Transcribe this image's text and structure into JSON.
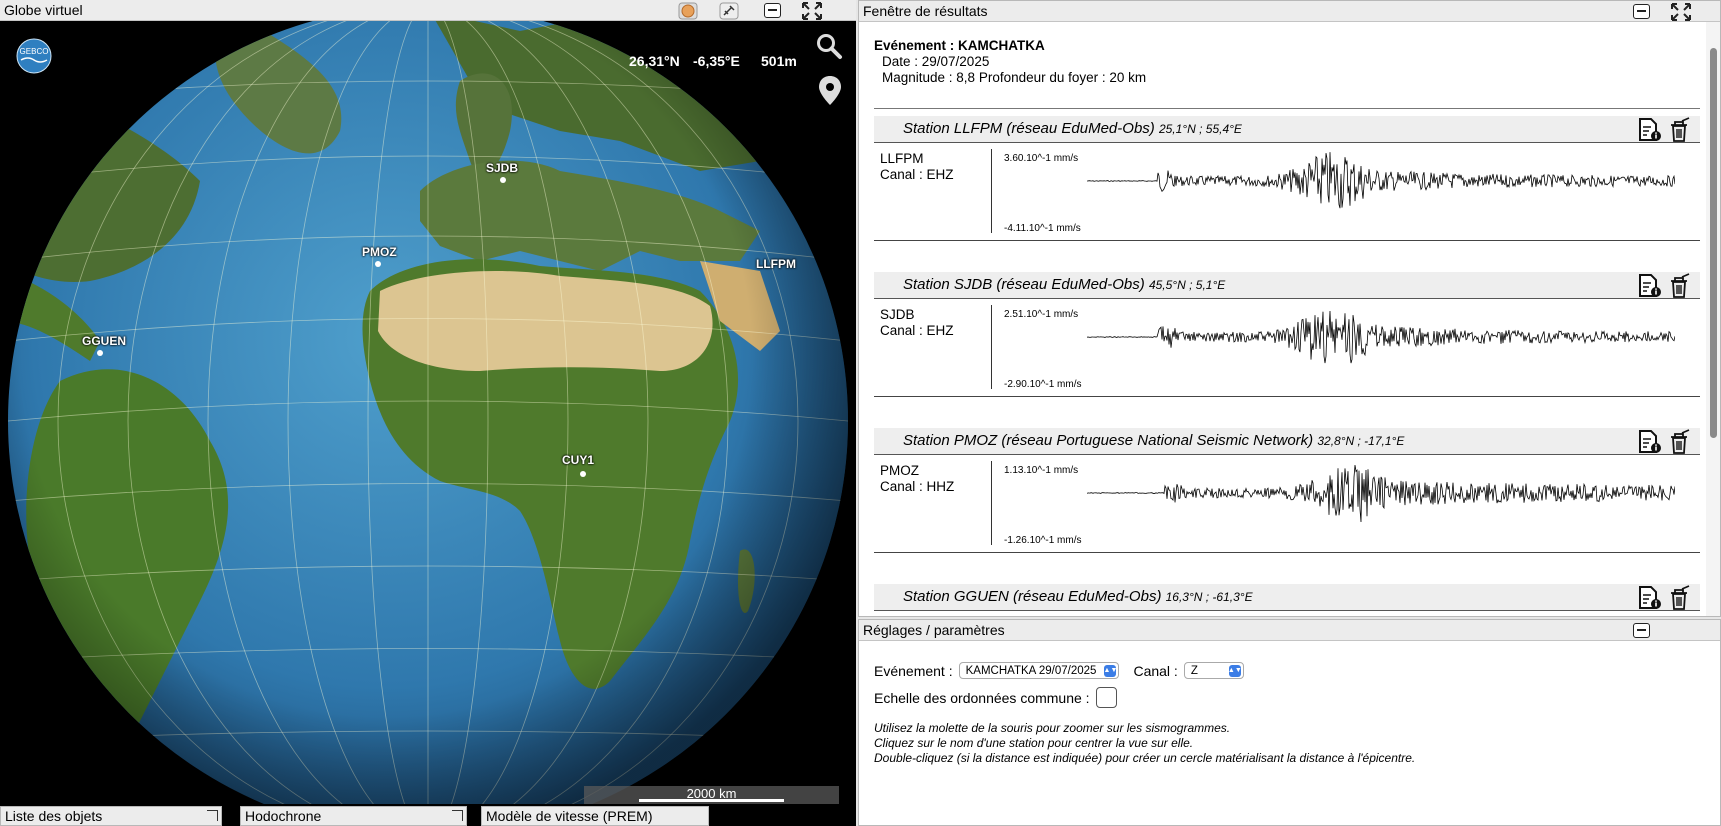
{
  "globe": {
    "title": "Globe virtuel",
    "latitude": "26,31°N",
    "longitude": "-6,35°E",
    "altitude": "501m",
    "logo_text": "GEBCO",
    "stations": [
      {
        "code": "SJDB"
      },
      {
        "code": "PMOZ"
      },
      {
        "code": "LLFPM"
      },
      {
        "code": "GGUEN"
      },
      {
        "code": "CUY1"
      }
    ],
    "scale_label": "2000 km",
    "tabs": {
      "objects": "Liste des objets",
      "hodochrone": "Hodochrone",
      "velocity": "Modèle de vitesse (PREM)"
    }
  },
  "results": {
    "title": "Fenêtre de résultats",
    "event": {
      "title": "Evénement : KAMCHATKA",
      "date": "Date : 29/07/2025",
      "details": "Magnitude : 8,8  Profondeur du foyer : 20 km"
    },
    "stations": [
      {
        "title": "Station LLFPM (réseau EduMed-Obs)",
        "coords": "25,1°N ; 55,4°E",
        "code": "LLFPM",
        "channel": "Canal : EHZ",
        "amp_max": "3.60.10^-1 mm/s",
        "amp_min": "-4.11.10^-1 mm/s",
        "onset": 0.12,
        "peak": 0.42,
        "decay": 0.18
      },
      {
        "title": "Station SJDB (réseau EduMed-Obs)",
        "coords": "45,5°N ; 5,1°E",
        "code": "SJDB",
        "channel": "Canal : EHZ",
        "amp_max": "2.51.10^-1 mm/s",
        "amp_min": "-2.90.10^-1 mm/s",
        "onset": 0.12,
        "peak": 0.42,
        "decay": 0.2
      },
      {
        "title": "Station PMOZ (réseau Portuguese National Seismic Network)",
        "coords": "32,8°N ; -17,1°E",
        "code": "PMOZ",
        "channel": "Canal : HHZ",
        "amp_max": "1.13.10^-1 mm/s",
        "amp_min": "-1.26.10^-1 mm/s",
        "onset": 0.13,
        "peak": 0.45,
        "decay": 0.45
      },
      {
        "title": "Station GGUEN (réseau EduMed-Obs)",
        "coords": "16,3°N ; -61,3°E"
      }
    ]
  },
  "settings": {
    "title": "Réglages / paramètres",
    "event_label": "Evénement :",
    "event_value": "KAMCHATKA 29/07/2025",
    "channel_label": "Canal :",
    "channel_value": "Z",
    "scale_label": "Echelle des ordonnées commune :",
    "help": [
      "Utilisez la molette de la souris pour zoomer sur les sismogrammes.",
      "Cliquez sur le nom d'une station pour centrer la vue sur elle.",
      "Double-cliquez (si la distance est indiquée) pour créer un cercle matérialisant la distance à l'épicentre."
    ]
  },
  "colors": {
    "ocean": "#3f86b8",
    "land": "#4a6b2f",
    "desert": "#d9c28a",
    "accent": "#3b7de6"
  }
}
